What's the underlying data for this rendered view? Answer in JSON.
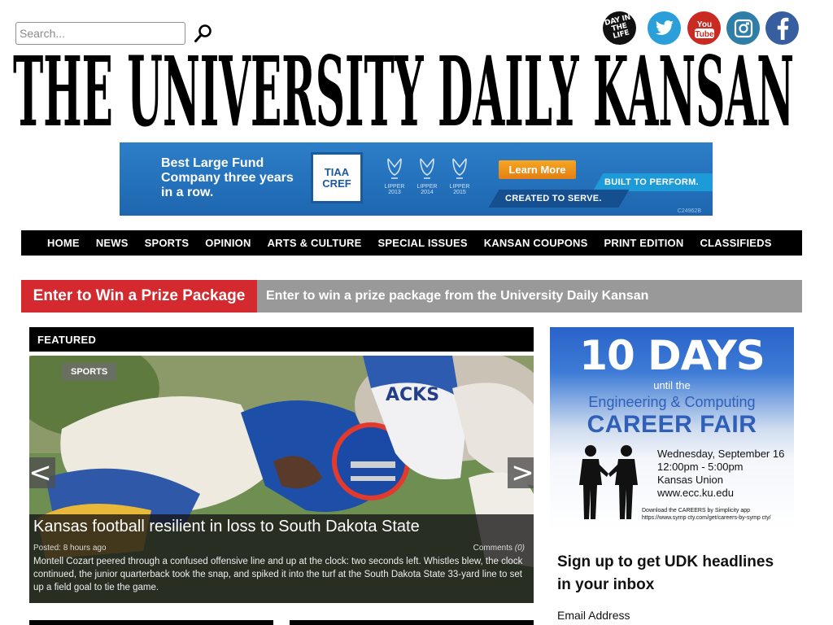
{
  "search": {
    "placeholder": "Search..."
  },
  "social": {
    "day_in_life": "DAY IN THE LIFE",
    "items": [
      "day-in-the-life",
      "twitter",
      "youtube",
      "instagram",
      "facebook"
    ],
    "youtube_label": "You Tube"
  },
  "masthead": {
    "title": "THE UNIVERSITY DAILY KANSAN"
  },
  "ad_banner": {
    "headline": "Best Large Fund Company three years in a row.",
    "logo_line1": "TIAA",
    "logo_line2": "CREF",
    "awards": [
      {
        "label": "LIPPER",
        "year": "2013"
      },
      {
        "label": "LIPPER",
        "year": "2014"
      },
      {
        "label": "LIPPER",
        "year": "2015"
      }
    ],
    "cta": "Learn More",
    "tagline1": "BUILT TO PERFORM.",
    "tagline2": "CREATED TO SERVE.",
    "code": "C24962B"
  },
  "nav": {
    "items": [
      "HOME",
      "NEWS",
      "SPORTS",
      "OPINION",
      "ARTS & CULTURE",
      "SPECIAL ISSUES",
      "KANSAN COUPONS",
      "PRINT EDITION",
      "CLASSIFIEDS"
    ]
  },
  "promo": {
    "label": "Enter to Win a Prize Package",
    "text": "Enter to win a prize package from the University Daily Kansan"
  },
  "featured": {
    "header": "FEATURED",
    "category": "SPORTS",
    "prev": "<",
    "next": ">",
    "title": "Kansas football resilient in loss to South Dakota State",
    "posted": "Posted: 8 hours ago",
    "comments_label": "Comments",
    "comments_count": "(0)",
    "excerpt": "Montell Cozart peered through a confused offensive line and up at the clock: two seconds left. Whistles blew, the clock continued, the junior quarterback took the snap, and spiked it into the turf at the South Dakota State 33-yard line to set up a field goal to tie the game."
  },
  "side_ad": {
    "big": "10 DAYS",
    "until": "until the",
    "eng": "Engineering & Computing",
    "career": "CAREER FAIR",
    "info": [
      "Wednesday, September 16",
      "12:00pm - 5:00pm",
      "Kansas Union",
      "www.ecc.ku.edu"
    ],
    "fine1": "Download the CAREERS by Simplicity app",
    "fine2": "https://www.symp cty.com/get/careers-by-symp cty/"
  },
  "signup": {
    "title": "Sign up to get UDK headlines in your inbox",
    "email_label": "Email Address"
  },
  "colors": {
    "nav_bg": "#000000",
    "promo_red": "#d42a2f",
    "promo_gray": "#999999",
    "ad_blue": "#1e66b0"
  }
}
